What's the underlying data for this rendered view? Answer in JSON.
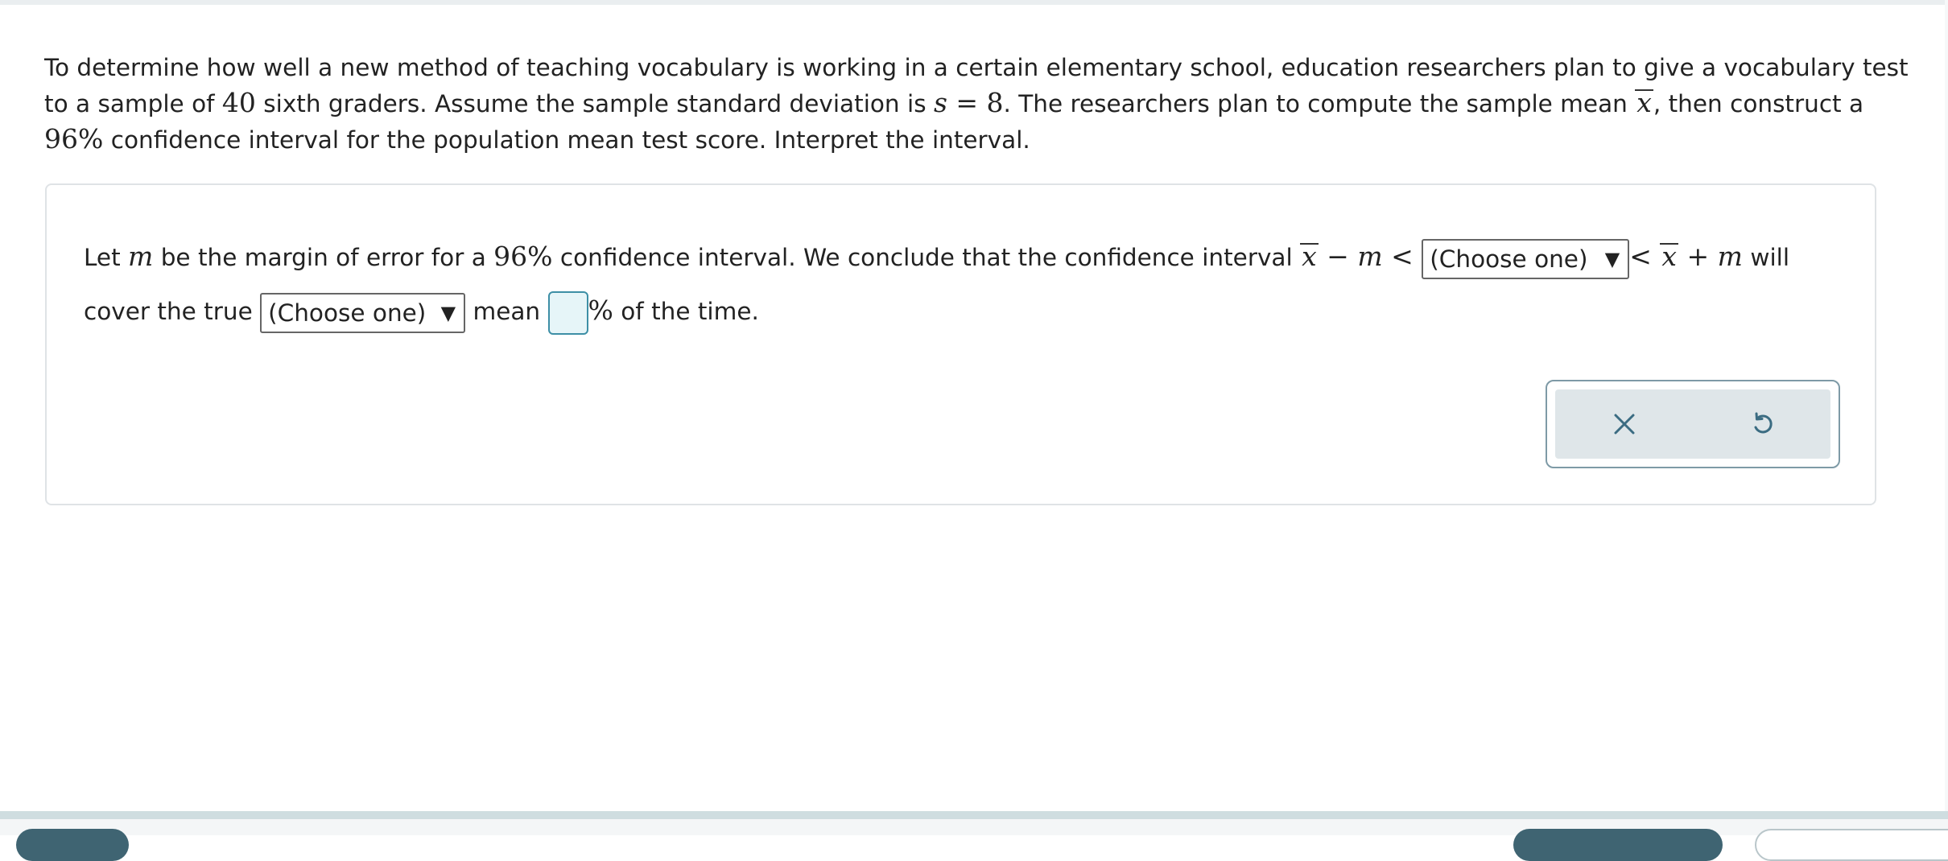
{
  "question": {
    "p1": "To determine how well a new method of teaching vocabulary is working in a certain elementary school, education researchers plan to give a vocabulary test to a sample of ",
    "n": "40",
    "p2": " sixth graders. Assume the sample standard deviation is ",
    "s_var": "s",
    "eq": " = ",
    "s_val": "8",
    "p3": ". The researchers plan to compute the sample mean ",
    "xbar": "x",
    "p4": ", then construct a ",
    "conf": "96%",
    "p5": " confidence interval for the population mean test score. Interpret the interval."
  },
  "answer": {
    "t1": "Let ",
    "m_var": "m",
    "t2": " be the margin of error for a ",
    "conf": "96%",
    "t3": " confidence interval. We conclude that the confidence interval ",
    "xbar": "x",
    "minus": " − ",
    "lt1": " < ",
    "dropdown1": "(Choose one)",
    "arrow": "▼",
    "lt2": "< ",
    "plus": " + ",
    "t4": " will cover the true ",
    "dropdown2": "(Choose one)",
    "t5": " mean ",
    "pct": "%",
    "t6": " of the time."
  },
  "icons": {
    "clear": "close-icon",
    "undo": "undo-icon"
  },
  "colors": {
    "input_border": "#3d8fa6",
    "input_fill": "#e6f5f8",
    "tool_bg": "#dfe6e9",
    "icon_color": "#3b6c82"
  }
}
